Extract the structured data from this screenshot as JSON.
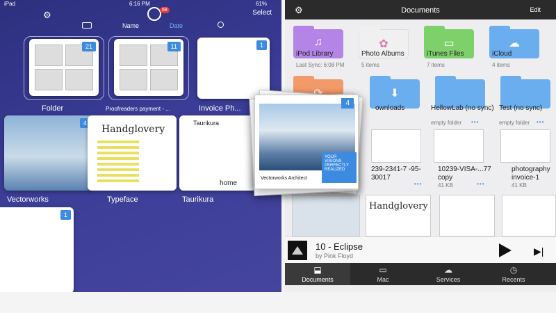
{
  "status": {
    "carrier": "iPad",
    "time": "6:16 PM",
    "battery": "61%"
  },
  "left": {
    "badge": "68",
    "select_label": "Select",
    "sort": {
      "name": "Name",
      "date": "Date"
    },
    "tiles": [
      {
        "label": "Folder",
        "count": "21"
      },
      {
        "label": "Proofreaders payment - ...",
        "count": "11"
      },
      {
        "label": "Invoice Ph...",
        "count": "1"
      },
      {
        "label": "Vectorworks",
        "count": "4"
      },
      {
        "label": "Typeface",
        "count": ""
      },
      {
        "label": "Taurikura",
        "count": ""
      },
      {
        "label": "",
        "count": "1"
      }
    ],
    "typeface_text": "Handglovery",
    "taurikura_text": "Taurikura",
    "home_text": "home"
  },
  "drag": {
    "count": "4",
    "brand": "Vectorworks Architect",
    "tagline": "YOUR VISIONS PERFECTLY REALIZED"
  },
  "right": {
    "title": "Documents",
    "edit_label": "Edit",
    "folders": [
      {
        "label": "iPod Library",
        "sub": "Last Sync: 6:08 PM",
        "color": "#b484e6"
      },
      {
        "label": "Photo Albums",
        "sub": "5 items",
        "color": "#f0f0f0"
      },
      {
        "label": "iTunes Files",
        "sub": "7 items",
        "color": "#7dd06a"
      },
      {
        "label": "iCloud",
        "sub": "4 items",
        "color": "#6aaef0"
      },
      {
        "label": "",
        "sub": "",
        "color": "#f29a6a"
      },
      {
        "label": "ownloads",
        "sub": "",
        "color": "#6aaef0"
      },
      {
        "label": "HellowLab (no sync)",
        "sub": "empty folder",
        "color": "#6aaef0"
      },
      {
        "label": "Test (no sync)",
        "sub": "empty folder",
        "color": "#6aaef0"
      }
    ],
    "docs": [
      {
        "label": "239-2341-7 -95-30017",
        "sub": ""
      },
      {
        "label": "10239-VISA-...77 copy",
        "sub": "41 KB"
      },
      {
        "label": "photography invoice-1",
        "sub": "41 KB"
      }
    ],
    "bottom_doc_text": "Handglovery",
    "now_playing": {
      "title": "10 - Eclipse",
      "artist": "by Pink Floyd"
    },
    "tabs": [
      {
        "label": "Documents",
        "icon": "download-tray-icon"
      },
      {
        "label": "Mac",
        "icon": "monitor-icon"
      },
      {
        "label": "Services",
        "icon": "cloud-icon"
      },
      {
        "label": "Recents",
        "icon": "clock-icon"
      }
    ]
  }
}
